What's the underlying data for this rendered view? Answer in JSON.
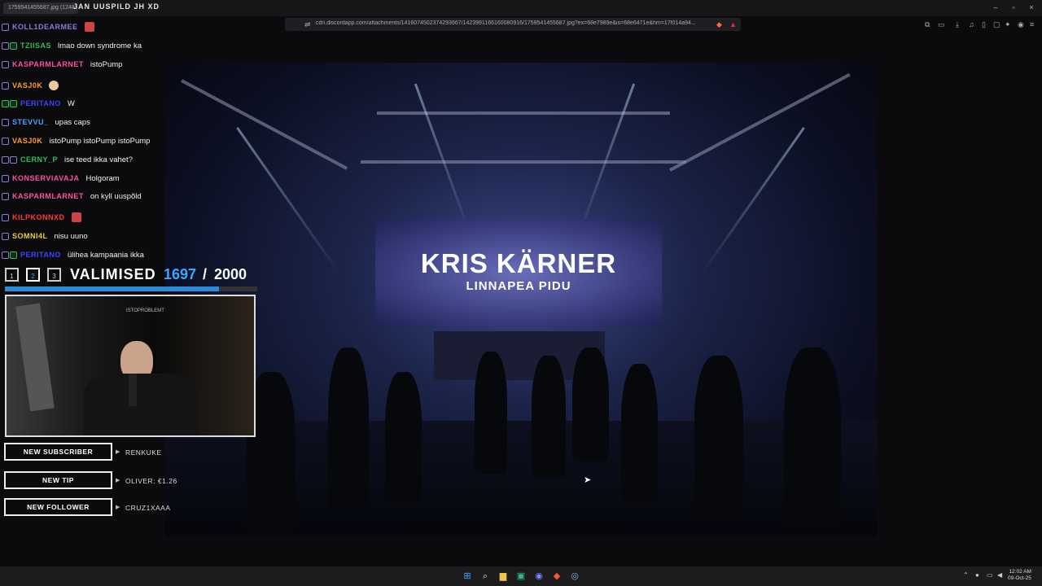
{
  "window": {
    "tab_text": "1759541455687.jpg (1248",
    "title": "JAN UUSPILD JH XD",
    "controls": [
      "–",
      "▫",
      "×"
    ]
  },
  "browser": {
    "url": "cdn.discordapp.com/attachments/1416074502374293667/1423991166160080916/1759541455687.jpg?ex=68e7989e&is=68e6471e&hm=17f014a94..."
  },
  "chat": {
    "messages": [
      {
        "user": "KOLL1DEARMEE",
        "text": "",
        "color": "#8a7bd8",
        "emote": "red",
        "badge": "v"
      },
      {
        "user": "TZIISAS",
        "text": "lmao down syndrome ka",
        "color": "#2fbf5a",
        "badge": "v"
      },
      {
        "user": "KASPARMLARNET",
        "text": "istoPump",
        "color": "#ff4fa3",
        "badge": "v"
      },
      {
        "user": "VASJ0K",
        "text": "",
        "color": "#ff9d2e",
        "emote": "face",
        "badge": "v"
      },
      {
        "user": "PERITANO",
        "text": "W",
        "color": "#3a44ff",
        "badge": "g"
      },
      {
        "user": "STEVVU_",
        "text": "upas caps",
        "color": "#4aa3ff",
        "badge": "v"
      },
      {
        "user": "VASJ0K",
        "text": "istoPump istoPump istoPump",
        "color": "#ff9d2e",
        "badge": "v"
      },
      {
        "user": "CERNY_P",
        "text": "ise teed ikka vahet?",
        "color": "#2fbf5a",
        "badge": "v"
      },
      {
        "user": "KONSERVIAVAJA",
        "text": "Holgoram",
        "color": "#ff4fa3",
        "badge": "v"
      },
      {
        "user": "KASPARMLARNET",
        "text": "on kyll uuspõld",
        "color": "#ff4fa3",
        "badge": "v"
      },
      {
        "user": "KILPKONNXD",
        "text": "",
        "color": "#ff3b3b",
        "emote": "red",
        "badge": "v"
      },
      {
        "user": "SOMNI4L",
        "text": "nisu uuno",
        "color": "#e8d22e",
        "badge": "v"
      },
      {
        "user": "PERITANO",
        "text": "ülihea kampaania ikka",
        "color": "#3a44ff",
        "badge": "g"
      }
    ]
  },
  "goal": {
    "tabs": [
      "1",
      "2",
      "3"
    ],
    "active_tab": 1,
    "label": "VALIMISED",
    "current": "1697",
    "separator": "/",
    "target": "2000",
    "progress": 0.8485
  },
  "webcam": {
    "sign_text": "ISTOPROBLEMT"
  },
  "alerts": [
    {
      "label": "NEW SUBSCRIBER",
      "value": "RENKUKE"
    },
    {
      "label": "NEW TIP",
      "value": "OLIVER: €1.26"
    },
    {
      "label": "NEW FOLLOWER",
      "value": "CRUZ1XAAA"
    }
  ],
  "stage": {
    "headline": "KRIS KÄRNER",
    "subline": "LINNAPEA PIDU"
  },
  "taskbar": {
    "icons": [
      "windows-start-icon",
      "search-icon",
      "file-explorer-icon",
      "app-icon",
      "discord-icon",
      "brave-icon",
      "steam-icon"
    ],
    "time": "12:02 AM",
    "date": "09-Oct-25"
  }
}
